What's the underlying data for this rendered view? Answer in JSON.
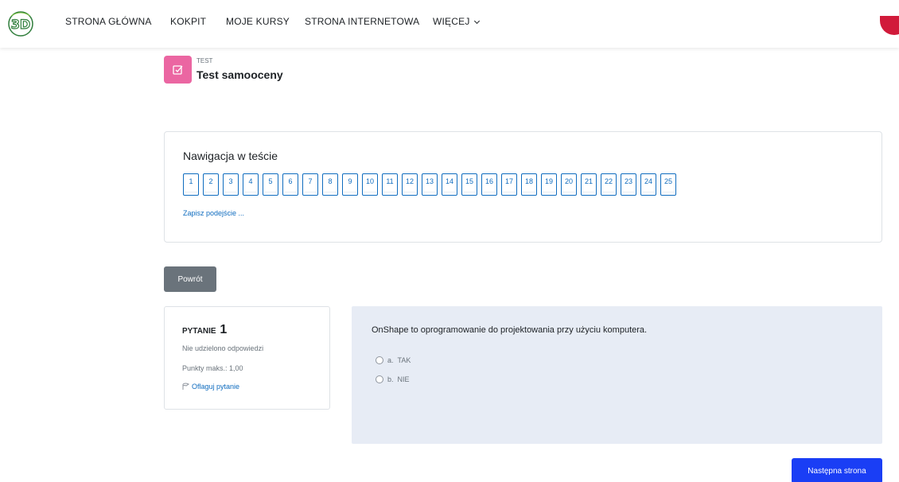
{
  "navbar": {
    "logo_text": "3D",
    "items": [
      "STRONA GŁÓWNA",
      "KOKPIT",
      "MOJE KURSY",
      "STRONA INTERNETOWA",
      "WIĘCEJ"
    ]
  },
  "header": {
    "activity_type": "TEST",
    "title": "Test samooceny"
  },
  "quiz_nav": {
    "title": "Nawigacja w teście",
    "questions": [
      "1",
      "2",
      "3",
      "4",
      "5",
      "6",
      "7",
      "8",
      "9",
      "10",
      "11",
      "12",
      "13",
      "14",
      "15",
      "16",
      "17",
      "18",
      "19",
      "20",
      "21",
      "22",
      "23",
      "24",
      "25"
    ],
    "finish_link": "Zapisz podejście ..."
  },
  "back_button": "Powrót",
  "question_info": {
    "label": "PYTANIE",
    "number": "1",
    "state": "Nie udzielono odpowiedzi",
    "grade": "Punkty maks.: 1,00",
    "flag": "Oflaguj pytanie"
  },
  "question": {
    "text": "OnShape to oprogramowanie do projektowania przy użyciu komputera.",
    "answers": [
      {
        "letter": "a.",
        "label": "TAK"
      },
      {
        "letter": "b.",
        "label": "NIE"
      }
    ]
  },
  "next_button": "Następna strona",
  "colors": {
    "primary": "#0f6cbf",
    "next_button": "#1a3ef5",
    "quiz_icon": "#eb66a2",
    "secondary_button": "#6a737b",
    "question_bg": "#e7ecf5"
  }
}
